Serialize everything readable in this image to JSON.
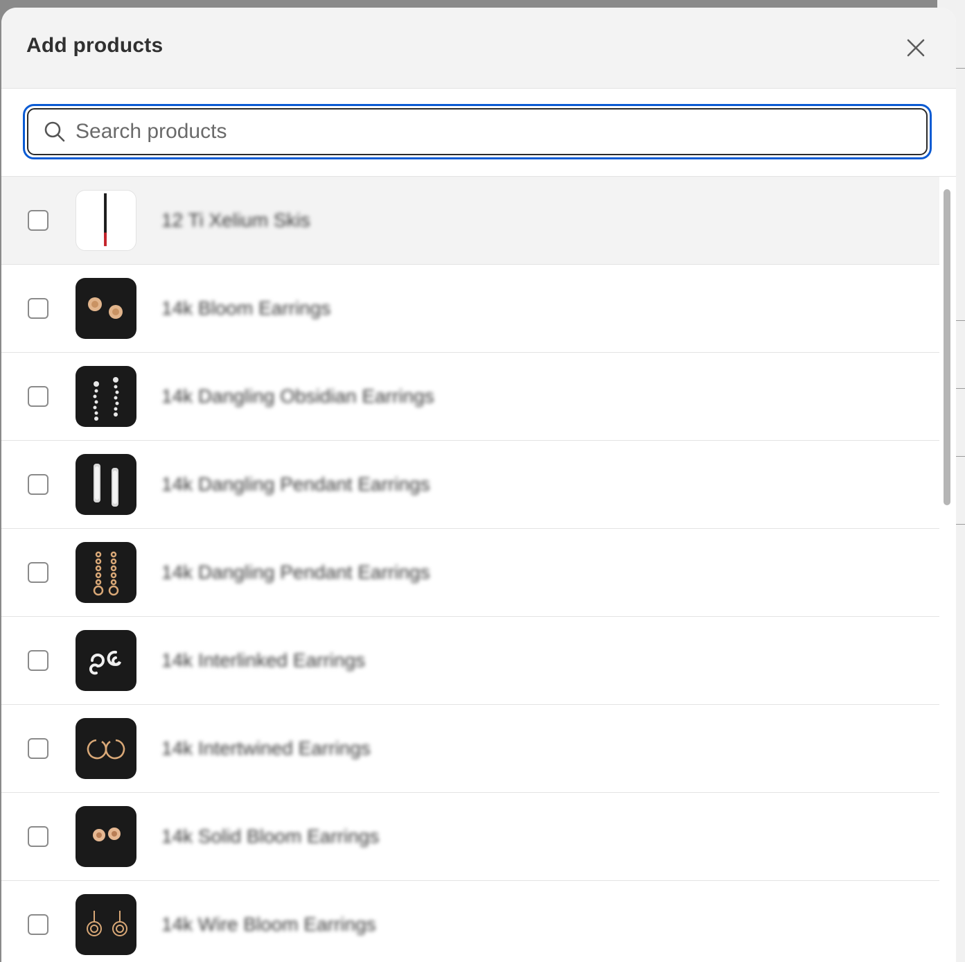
{
  "dialog": {
    "title": "Add products"
  },
  "search": {
    "placeholder": "Search products",
    "value": ""
  },
  "products": [
    {
      "name": "12 Ti Xelium Skis",
      "thumb": "ski-image"
    },
    {
      "name": "14k Bloom Earrings",
      "thumb": "bloom-earrings-image"
    },
    {
      "name": "14k Dangling Obsidian Earrings",
      "thumb": "dangling-obsidian-earrings-image"
    },
    {
      "name": "14k Dangling Pendant Earrings",
      "thumb": "dangling-pendant-earrings-image"
    },
    {
      "name": "14k Dangling Pendant Earrings",
      "thumb": "dangling-pendant-gold-earrings-image"
    },
    {
      "name": "14k Interlinked Earrings",
      "thumb": "interlinked-earrings-image"
    },
    {
      "name": "14k Intertwined Earrings",
      "thumb": "intertwined-earrings-image"
    },
    {
      "name": "14k Solid Bloom Earrings",
      "thumb": "solid-bloom-earrings-image"
    },
    {
      "name": "14k Wire Bloom Earrings",
      "thumb": "wire-bloom-earrings-image"
    }
  ],
  "colors": {
    "focus_ring": "#0b5bd3",
    "header_bg": "#f3f3f3",
    "thumb_bg": "#1a1a1a",
    "gold": "#d9a877"
  }
}
